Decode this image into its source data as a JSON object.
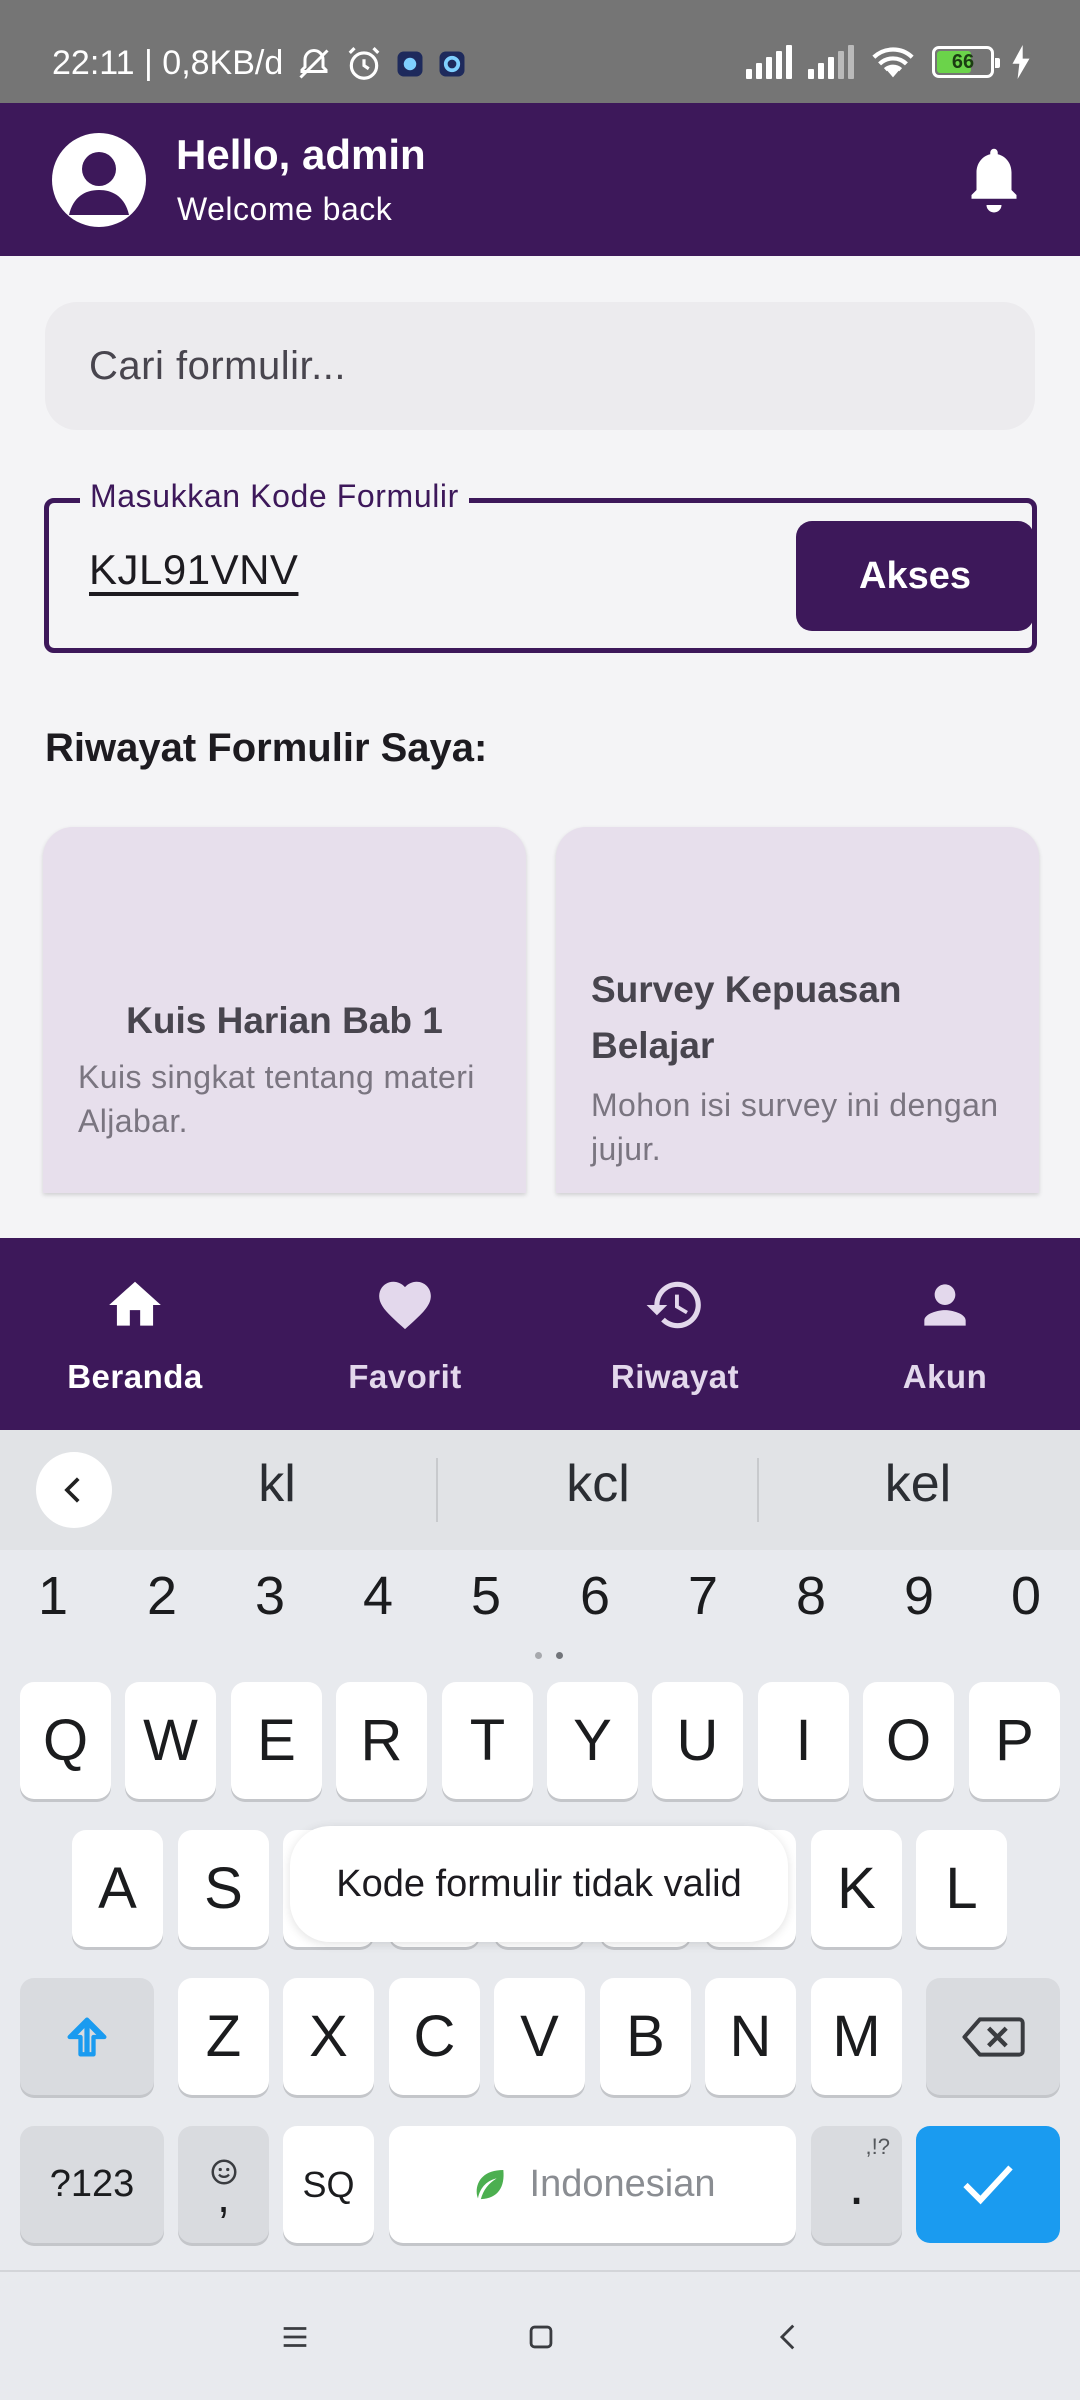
{
  "status_bar": {
    "time_speed": "22:11 | 0,8KB/d",
    "battery": "66",
    "icons": [
      "mute-icon",
      "alarm-icon",
      "app-icon",
      "app-icon",
      "signal-icon",
      "signal-icon",
      "wifi-icon",
      "battery-icon",
      "charging-icon"
    ]
  },
  "header": {
    "greeting": "Hello, admin",
    "subtitle": "Welcome back",
    "icons": [
      "avatar-icon",
      "bell-icon"
    ]
  },
  "search": {
    "placeholder": "Cari formulir..."
  },
  "code_form": {
    "label": "Masukkan Kode Formulir",
    "value": "KJL91VNV",
    "button": "Akses"
  },
  "history": {
    "title": "Riwayat Formulir Saya:",
    "cards": [
      {
        "title": "Kuis Harian Bab 1",
        "description": "Kuis singkat tentang materi Aljabar."
      },
      {
        "title": "Survey Kepuasan Belajar",
        "description": "Mohon isi survey ini dengan jujur."
      }
    ]
  },
  "bottom_nav": {
    "items": [
      {
        "label": "Beranda",
        "icon": "home-icon",
        "active": true
      },
      {
        "label": "Favorit",
        "icon": "heart-icon",
        "active": false
      },
      {
        "label": "Riwayat",
        "icon": "history-icon",
        "active": false
      },
      {
        "label": "Akun",
        "icon": "person-icon",
        "active": false
      }
    ]
  },
  "keyboard": {
    "suggestions": [
      "kl",
      "kcl",
      "kel"
    ],
    "numbers": [
      "1",
      "2",
      "3",
      "4",
      "5",
      "6",
      "7",
      "8",
      "9",
      "0"
    ],
    "row1": [
      "Q",
      "W",
      "E",
      "R",
      "T",
      "Y",
      "U",
      "I",
      "O",
      "P"
    ],
    "row2": [
      "A",
      "S",
      "D",
      "F",
      "G",
      "H",
      "J",
      "K",
      "L"
    ],
    "row3": [
      "Z",
      "X",
      "C",
      "V",
      "B",
      "N",
      "M"
    ],
    "symbols_key": "?123",
    "emoji_key": ",",
    "lang_key": "SQ",
    "space_label": "Indonesian",
    "period_key": ".",
    "period_hint": ",!?"
  },
  "toast": {
    "message": "Kode formulir tidak valid"
  },
  "colors": {
    "primary": "#3d185a",
    "card_bg": "#e7dfec",
    "enter_key": "#1a9bf0"
  }
}
